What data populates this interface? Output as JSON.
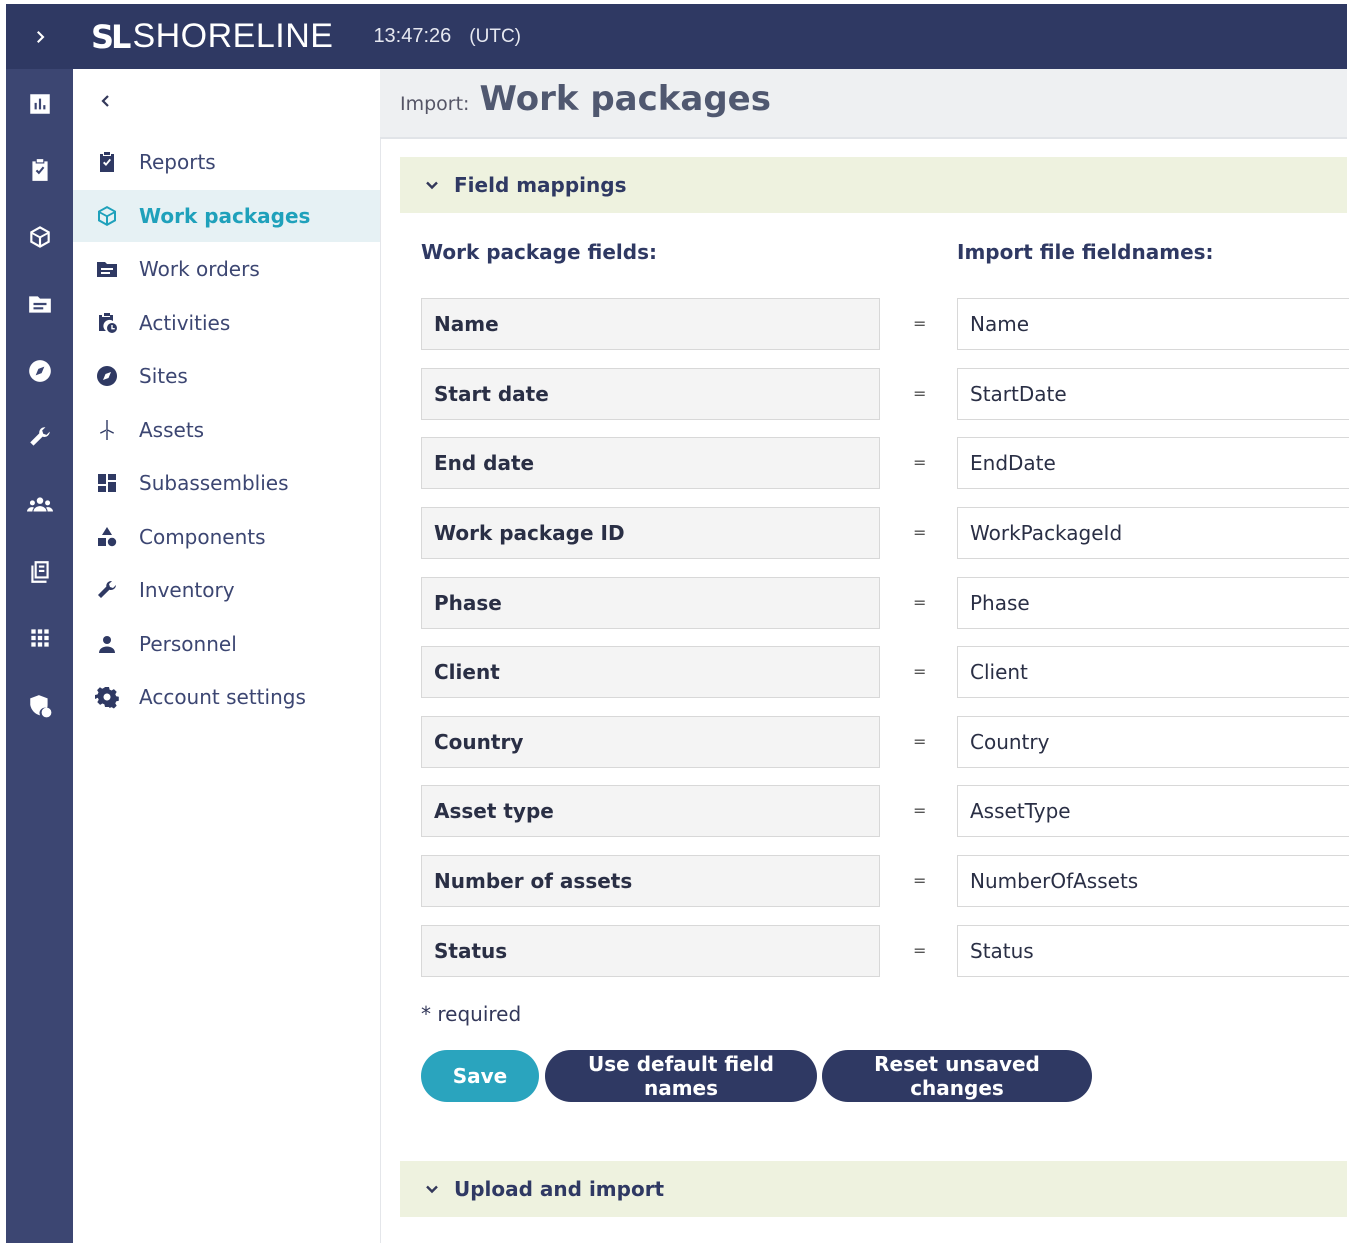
{
  "topbar": {
    "logo_mark": "SL",
    "logo_text": "SHORELINE",
    "clock": "13:47:26",
    "timezone": "(UTC)"
  },
  "rail": {
    "expand_icon": "chevron-right-icon",
    "icons": [
      "chart-icon",
      "clipboard-check-icon",
      "cube-icon",
      "folder-icon",
      "compass-icon",
      "wrench-icon",
      "people-icon",
      "documents-icon",
      "grid-icon",
      "shield-user-icon"
    ]
  },
  "subnav": {
    "collapse_icon": "chevron-left-icon",
    "items": [
      {
        "label": "Reports",
        "icon": "clipboard-check-icon"
      },
      {
        "label": "Work packages",
        "icon": "cube-icon",
        "active": true
      },
      {
        "label": "Work orders",
        "icon": "folder-icon"
      },
      {
        "label": "Activities",
        "icon": "clipboard-clock-icon"
      },
      {
        "label": "Sites",
        "icon": "compass-icon"
      },
      {
        "label": "Assets",
        "icon": "wind-turbine-icon"
      },
      {
        "label": "Subassemblies",
        "icon": "dashboard-icon"
      },
      {
        "label": "Components",
        "icon": "shapes-icon"
      },
      {
        "label": "Inventory",
        "icon": "wrench-icon"
      },
      {
        "label": "Personnel",
        "icon": "person-icon"
      },
      {
        "label": "Account settings",
        "icon": "gear-icon"
      }
    ]
  },
  "header": {
    "prefix": "Import:",
    "title": "Work packages"
  },
  "field_mappings": {
    "title": "Field mappings",
    "left_heading": "Work package fields:",
    "right_heading": "Import file fieldnames:",
    "equals": "=",
    "rows": [
      {
        "field": "Name",
        "value": "Name"
      },
      {
        "field": "Start date",
        "value": "StartDate"
      },
      {
        "field": "End date",
        "value": "EndDate"
      },
      {
        "field": "Work package ID",
        "value": "WorkPackageId"
      },
      {
        "field": "Phase",
        "value": "Phase"
      },
      {
        "field": "Client",
        "value": "Client"
      },
      {
        "field": "Country",
        "value": "Country"
      },
      {
        "field": "Asset type",
        "value": "AssetType"
      },
      {
        "field": "Number of assets",
        "value": "NumberOfAssets"
      },
      {
        "field": "Status",
        "value": "Status"
      }
    ],
    "required_note": "* required",
    "buttons": {
      "save": "Save",
      "defaults": "Use default field names",
      "reset": "Reset unsaved changes"
    }
  },
  "upload": {
    "title": "Upload and import"
  },
  "colors": {
    "nav_dark": "#2f3963",
    "rail": "#3c4672",
    "accent": "#2aa4be",
    "panel_bar": "#eef2df"
  }
}
